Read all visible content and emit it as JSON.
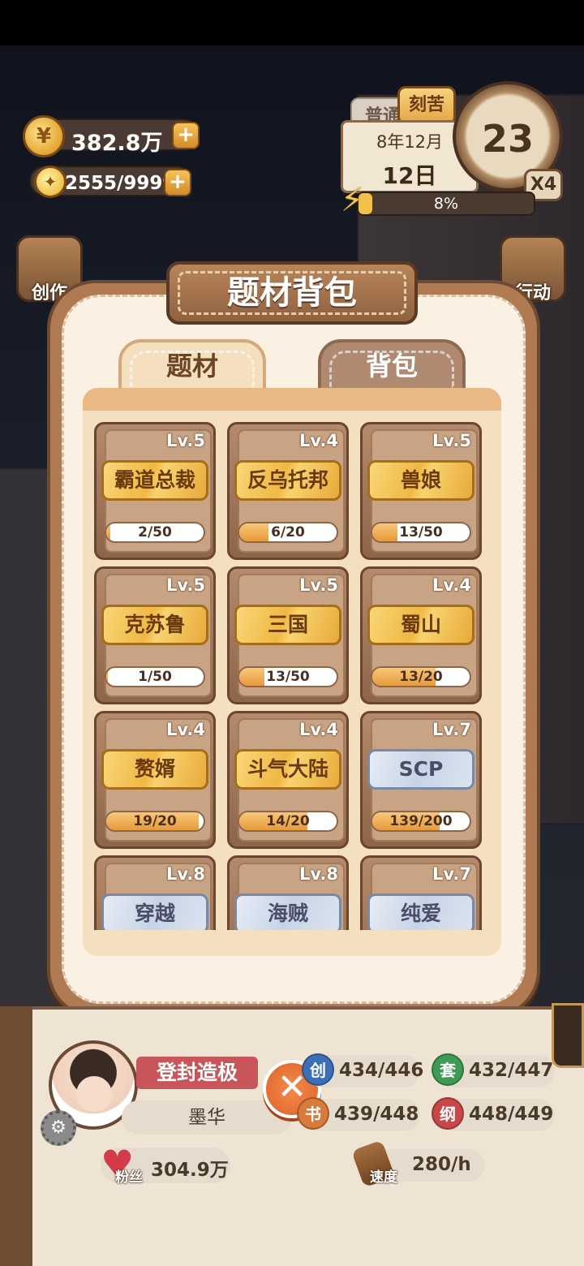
{
  "top_hud": {
    "coins": "382.8万",
    "inspiration": "2555/9999",
    "plus": "+"
  },
  "calendar": {
    "mode_normal": "普通",
    "mode_hard": "刻苦",
    "month": "8年12月",
    "day": "12日",
    "clock_value": "23",
    "speed_multiplier": "X4",
    "energy_percent_text": "8%",
    "energy_fraction": 0.08
  },
  "side_buttons": {
    "left": [
      "创作"
    ],
    "right": [
      "行动"
    ]
  },
  "panel": {
    "title": "题材背包",
    "tabs": [
      {
        "label": "题材",
        "active": true
      },
      {
        "label": "背包",
        "active": false
      }
    ],
    "cards": [
      {
        "level": "Lv.5",
        "name": "霸道总裁",
        "style": "gold",
        "progress": "2/50",
        "fraction": 0.04
      },
      {
        "level": "Lv.4",
        "name": "反乌托邦",
        "style": "gold",
        "progress": "6/20",
        "fraction": 0.3
      },
      {
        "level": "Lv.5",
        "name": "兽娘",
        "style": "gold",
        "progress": "13/50",
        "fraction": 0.26
      },
      {
        "level": "Lv.5",
        "name": "克苏鲁",
        "style": "gold",
        "progress": "1/50",
        "fraction": 0.02
      },
      {
        "level": "Lv.5",
        "name": "三国",
        "style": "gold",
        "progress": "13/50",
        "fraction": 0.26
      },
      {
        "level": "Lv.4",
        "name": "蜀山",
        "style": "gold",
        "progress": "13/20",
        "fraction": 0.65
      },
      {
        "level": "Lv.4",
        "name": "赘婿",
        "style": "gold",
        "progress": "19/20",
        "fraction": 0.95
      },
      {
        "level": "Lv.4",
        "name": "斗气大陆",
        "style": "gold",
        "progress": "14/20",
        "fraction": 0.7
      },
      {
        "level": "Lv.7",
        "name": "SCP",
        "style": "blue",
        "progress": "139/200",
        "fraction": 0.695
      },
      {
        "level": "Lv.8",
        "name": "穿越",
        "style": "blue",
        "progress": "",
        "fraction": 0
      },
      {
        "level": "Lv.8",
        "name": "海贼",
        "style": "blue",
        "progress": "",
        "fraction": 0
      },
      {
        "level": "Lv.7",
        "name": "纯爱",
        "style": "blue",
        "progress": "",
        "fraction": 0
      }
    ]
  },
  "profile": {
    "rank": "登封造极",
    "name": "墨华",
    "close": "✕",
    "stats": [
      {
        "badge": "创",
        "value": "434/446",
        "color": "#3b6fb8"
      },
      {
        "badge": "套",
        "value": "432/447",
        "color": "#3f9a55"
      },
      {
        "badge": "书",
        "value": "439/448",
        "color": "#d77a3a"
      },
      {
        "badge": "纲",
        "value": "448/449",
        "color": "#c84848"
      }
    ],
    "fans_label": "粉丝",
    "fans_value": "304.9万",
    "speed_label": "速度",
    "speed_value": "280/h"
  }
}
